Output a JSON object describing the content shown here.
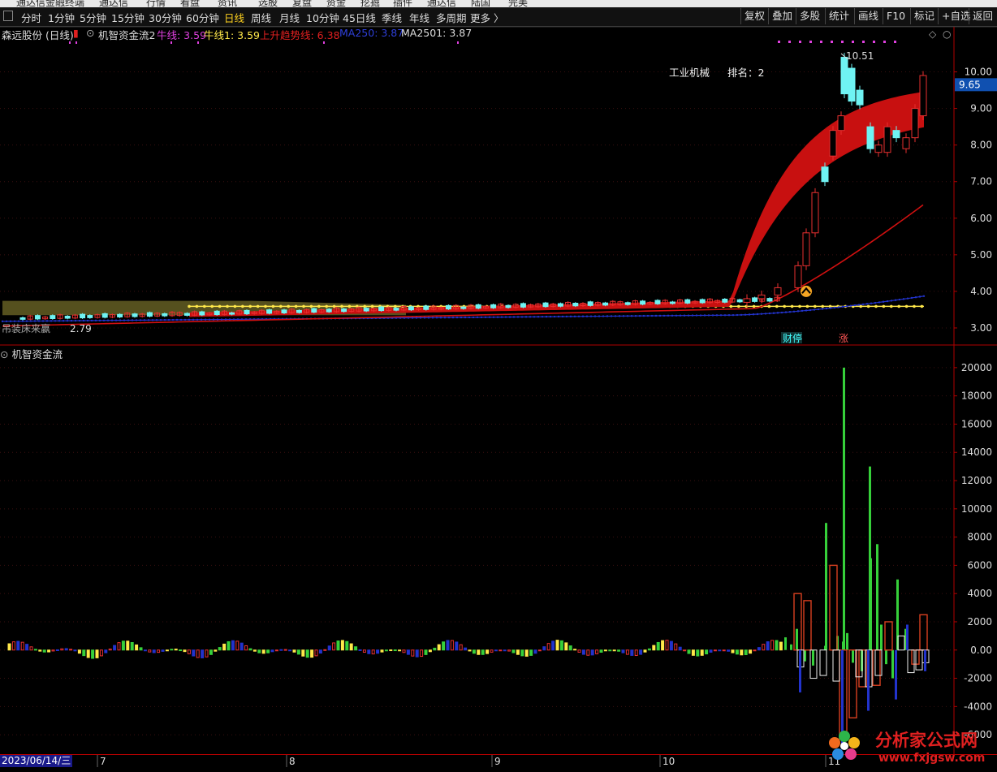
{
  "top_menu": [
    "通达信金融终端",
    "通达信",
    "行情",
    "看盘",
    "资讯",
    "选股",
    "复盘",
    "资金",
    "挖掘",
    "插件",
    "通达信",
    "陆国",
    "完美"
  ],
  "toolbar": {
    "periods": [
      "分时",
      "1分钟",
      "5分钟",
      "15分钟",
      "30分钟",
      "60分钟",
      "日线",
      "周线",
      "月线",
      "10分钟",
      "45日线",
      "季线",
      "年线",
      "多周期",
      "更多 〉"
    ],
    "active": "日线",
    "right_buttons": [
      "复权",
      "叠加",
      "多股",
      "统计",
      "画线",
      "F10",
      "标记",
      "+自选",
      "返回"
    ]
  },
  "main_legend": {
    "stock": "森远股份 (日线)",
    "indicator": "机智资金流2",
    "items": [
      {
        "label": "牛线: 3.59",
        "color": "#e040e0"
      },
      {
        "label": "牛线1: 3.59",
        "color": "#ffe84a"
      },
      {
        "label": "上升趋势线: 6.38",
        "color": "#e02020"
      },
      {
        "label": "MA250: 3.87",
        "color": "#2e3fd8"
      },
      {
        "label": "MA2501: 3.87",
        "color": "#dddddd"
      }
    ]
  },
  "annotations": {
    "industry": "工业机械",
    "rank": "排名：2",
    "high_label": "10.51",
    "low_label": "2.79",
    "current_price": "9.65",
    "left_text": "吊装床来赢",
    "event1": "财停",
    "event2": "涨"
  },
  "sub_legend": "机智资金流",
  "date_label": "2023/06/14/三",
  "month_labels": [
    "7",
    "8",
    "9",
    "10",
    "11"
  ],
  "watermark": {
    "title": "分析家公式网",
    "url": "www.fxjgsw.com"
  },
  "colors": {
    "up": "#e83030",
    "down": "#6ff3f3",
    "ribbon": "#c81010",
    "ma250": "#2233cc",
    "bull": "#ffe84a",
    "axis": "#b00000"
  },
  "chart_data": [
    {
      "type": "candlestick",
      "title": "森远股份 (日线)",
      "y_axis_ticks": [
        3.0,
        4.0,
        5.0,
        6.0,
        7.0,
        8.0,
        9.0,
        10.0
      ],
      "ylim": [
        2.6,
        10.9
      ],
      "series": [
        {
          "name": "MA250",
          "values_start": 3.2,
          "values_end": 3.87
        },
        {
          "name": "牛线",
          "value": 3.59
        },
        {
          "name": "上升趋势线",
          "end": 6.38
        }
      ],
      "candles_recent": [
        {
          "o": 3.7,
          "c": 3.8
        },
        {
          "o": 3.8,
          "c": 3.9
        },
        {
          "o": 3.9,
          "c": 4.1
        },
        {
          "o": 4.1,
          "c": 4.7
        },
        {
          "o": 4.7,
          "c": 5.6
        },
        {
          "o": 5.6,
          "c": 6.7
        },
        {
          "o": 7.4,
          "c": 7.0
        },
        {
          "o": 7.7,
          "c": 8.4
        },
        {
          "o": 8.4,
          "c": 8.8
        },
        {
          "o": 10.4,
          "c": 9.4
        },
        {
          "o": 10.1,
          "c": 9.2
        },
        {
          "o": 9.5,
          "c": 9.1
        },
        {
          "o": 8.5,
          "c": 7.9
        },
        {
          "o": 7.8,
          "c": 8.0
        },
        {
          "o": 7.8,
          "c": 8.5
        },
        {
          "o": 8.4,
          "c": 8.2
        },
        {
          "o": 7.9,
          "c": 8.2
        },
        {
          "o": 8.2,
          "c": 9.0
        },
        {
          "o": 8.8,
          "c": 9.9
        }
      ]
    },
    {
      "type": "bar",
      "title": "机智资金流",
      "y_axis_ticks": [
        -6000,
        -4000,
        -2000,
        0.0,
        2000,
        4000,
        6000,
        8000,
        10000,
        12000,
        14000,
        16000,
        18000,
        20000
      ],
      "ylim": [
        -7200,
        21200
      ],
      "series": [
        {
          "name": "green",
          "values": [
            900,
            400,
            1500,
            -800,
            -1100,
            300,
            1000,
            600,
            1200,
            -900,
            9000,
            20000,
            -1500,
            13000,
            7500,
            -1000,
            -2000,
            6500,
            1800,
            5000,
            1500
          ]
        },
        {
          "name": "hollow_red",
          "values": [
            4000,
            3500,
            6000,
            -6300,
            -4800,
            2000,
            -2600,
            -2500,
            -1000,
            2500
          ]
        }
      ]
    }
  ]
}
